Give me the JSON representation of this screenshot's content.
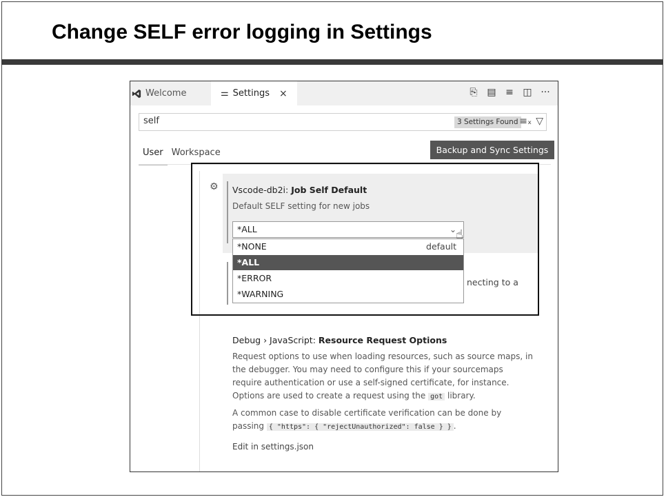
{
  "slide": {
    "title": "Change SELF error logging in Settings"
  },
  "tabs": [
    {
      "label": "Welcome"
    },
    {
      "label": "Settings",
      "close": "×"
    }
  ],
  "editor_actions": [
    "open-settings-json-icon",
    "split-json-icon",
    "more-actions-icon",
    "split-editor-icon",
    "ellipsis-icon"
  ],
  "search": {
    "value": "self",
    "found": "3 Settings Found"
  },
  "scope": {
    "user": "User",
    "workspace": "Workspace"
  },
  "backup_button": "Backup and Sync Settings",
  "setting_job_self": {
    "prefix": "Vscode-db2i: ",
    "name": "Job Self Default",
    "description": "Default SELF setting for new jobs",
    "selected": "*ALL",
    "options": [
      {
        "label": "*NONE",
        "tag": "default"
      },
      {
        "label": "*ALL",
        "tag": ""
      },
      {
        "label": "*ERROR",
        "tag": ""
      },
      {
        "label": "*WARNING",
        "tag": ""
      }
    ]
  },
  "setting_hidden_fragment": "necting to a",
  "setting_debug": {
    "prefix": "Debug › JavaScript: ",
    "name": "Resource Request Options",
    "desc_line1": "Request options to use when loading resources, such as source maps, in",
    "desc_line2": "the debugger. You may need to configure this if your sourcemaps",
    "desc_line3": "require authentication or use a self-signed certificate, for instance.",
    "desc_line4_a": "Options are used to create a request using the ",
    "desc_line4_code": "got",
    "desc_line4_b": " library.",
    "p2_line1": "A common case to disable certificate verification can be done by",
    "p2_line2_a": "passing ",
    "p2_line2_code": "{ \"https\": { \"rejectUnauthorized\": false } }",
    "p2_line2_b": ".",
    "edit_link": "Edit in settings.json"
  }
}
